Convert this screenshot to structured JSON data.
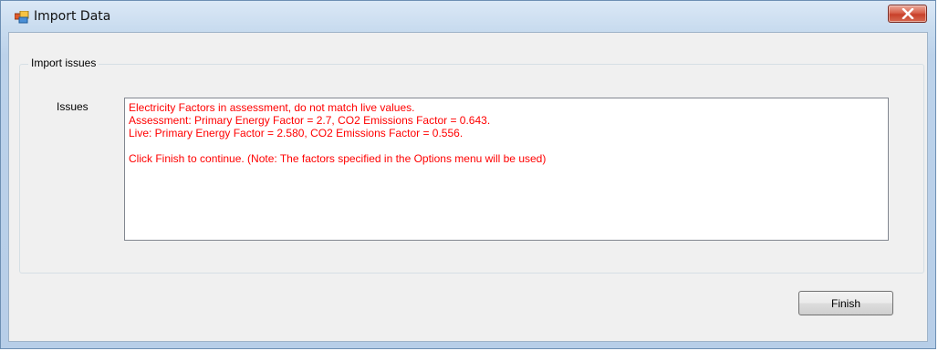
{
  "window": {
    "title": "Import Data",
    "app_icon": "application-icon",
    "close_icon": "close-icon"
  },
  "groupbox": {
    "label": "Import issues"
  },
  "issues": {
    "label": "Issues",
    "lines": [
      "Electricity Factors in assessment, do not match live values.",
      "Assessment: Primary Energy Factor = 2.7, CO2 Emissions Factor = 0.643.",
      "Live: Primary Energy Factor = 2.580, CO2 Emissions Factor = 0.556.",
      "",
      "Click Finish to continue. (Note: The factors specified in the Options menu will be used)"
    ],
    "text_color": "#ff0000"
  },
  "buttons": {
    "finish_label": "Finish"
  }
}
